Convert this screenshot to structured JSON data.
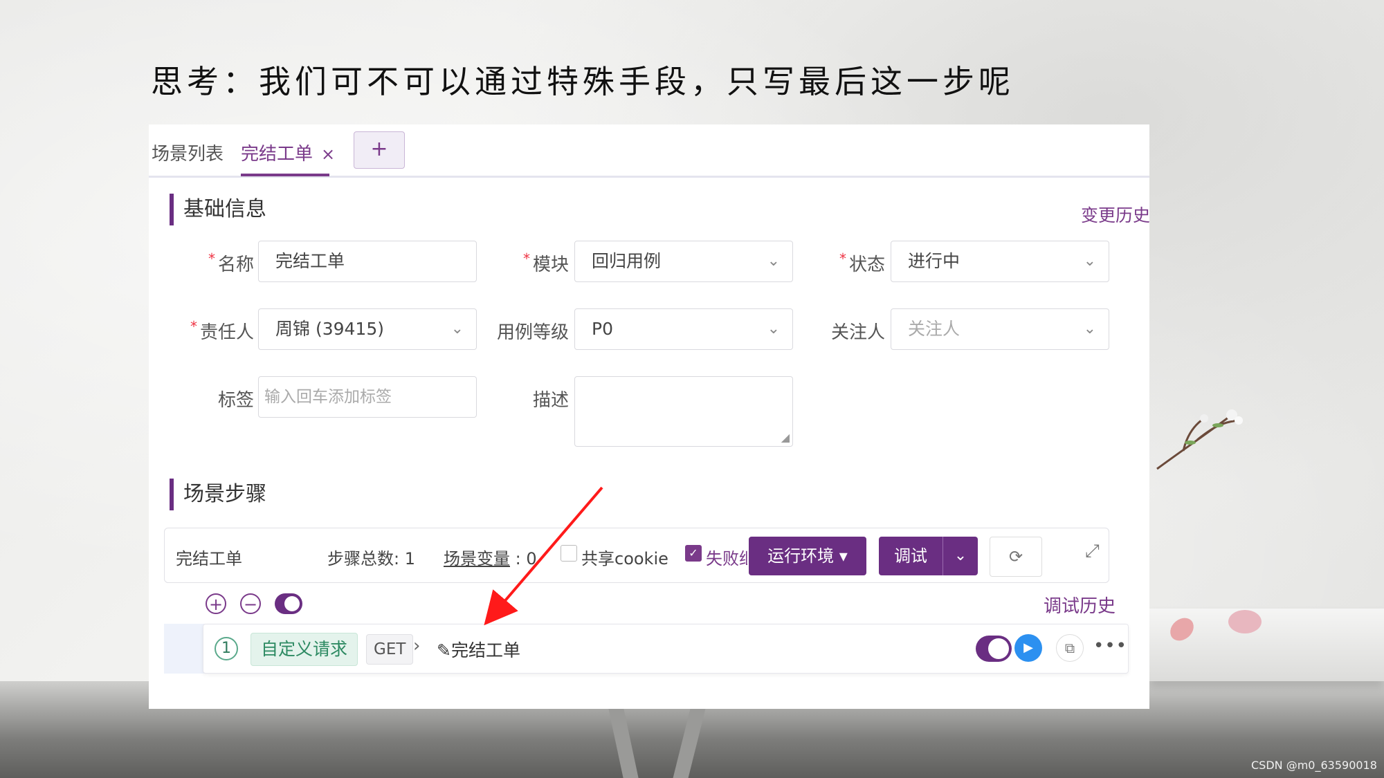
{
  "slide": {
    "title": "思考：我们可不可以通过特殊手段，只写最后这一步呢"
  },
  "tabs": {
    "scene_list": "场景列表",
    "active": "完结工单",
    "close": "×",
    "add": "+"
  },
  "basic_info": {
    "heading": "基础信息",
    "history_link": "变更历史",
    "required_mark": "*",
    "fields": {
      "name": {
        "label": "名称",
        "value": "完结工单"
      },
      "module": {
        "label": "模块",
        "value": "回归用例"
      },
      "status": {
        "label": "状态",
        "value": "进行中"
      },
      "owner": {
        "label": "责任人",
        "value": "周锦 (39415)"
      },
      "level": {
        "label": "用例等级",
        "value": "P0"
      },
      "watcher": {
        "label": "关注人",
        "placeholder": "关注人"
      },
      "tags": {
        "label": "标签",
        "placeholder": "输入回车添加标签"
      },
      "desc": {
        "label": "描述",
        "value": ""
      }
    }
  },
  "steps": {
    "heading": "场景步骤",
    "bar": {
      "scene_name": "完结工单",
      "total_label": "步骤总数:",
      "total_value": "1",
      "var_label": "场景变量",
      "var_value": "0",
      "share_cookie": "共享cookie",
      "fail_continue": "失败继续",
      "env_button": "运行环境",
      "debug_button": "调试"
    },
    "debug_history": "调试历史",
    "rows": [
      {
        "index": "1",
        "type": "自定义请求",
        "method": "GET",
        "name": "完结工单"
      }
    ]
  },
  "watermark": "CSDN @m0_63590018",
  "colors": {
    "accent": "#6a2e82",
    "link": "#7a3a8a",
    "required": "#e34",
    "play": "#2c90f0",
    "arrow": "#ff1a1a"
  }
}
